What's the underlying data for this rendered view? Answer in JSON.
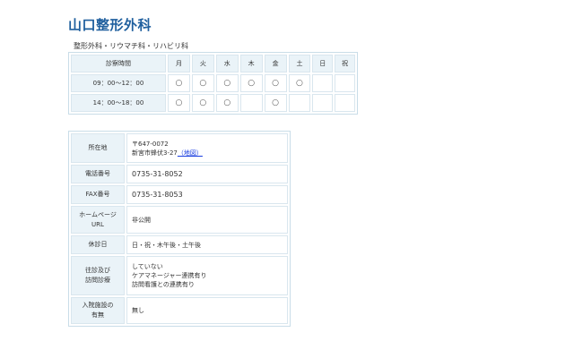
{
  "clinic": {
    "name": "山口整形外科",
    "departments": "整形外科・リウマチ科・リハビリ科"
  },
  "hours": {
    "header": [
      "診察時間",
      "月",
      "火",
      "水",
      "木",
      "金",
      "土",
      "日",
      "祝"
    ],
    "rows": [
      {
        "time": "09：00〜12：00",
        "marks": [
          "○",
          "○",
          "○",
          "○",
          "○",
          "○",
          "",
          ""
        ]
      },
      {
        "time": "14：00〜18：00",
        "marks": [
          "○",
          "○",
          "○",
          "",
          "○",
          "",
          "",
          ""
        ]
      }
    ]
  },
  "info": {
    "address_label": "所在地",
    "postal": "〒647-0072",
    "address": "新宮市蜂伏3-27",
    "map_link": "（地図）",
    "phone_label": "電話番号",
    "phone": "0735-31-8052",
    "fax_label": "FAX番号",
    "fax": "0735-31-8053",
    "homepage_label_1": "ホームページ",
    "homepage_label_2": "URL",
    "homepage": "非公開",
    "closed_label": "休診日",
    "closed": "日・祝・木午後・土午後",
    "visit_label_1": "往診及び",
    "visit_label_2": "訪問診療",
    "visit_1": "していない",
    "visit_2": "ケアマネージャー連携有り",
    "visit_3": "訪問看護との連携有り",
    "inpatient_label_1": "入院施設の",
    "inpatient_label_2": "有無",
    "inpatient": "無し"
  }
}
